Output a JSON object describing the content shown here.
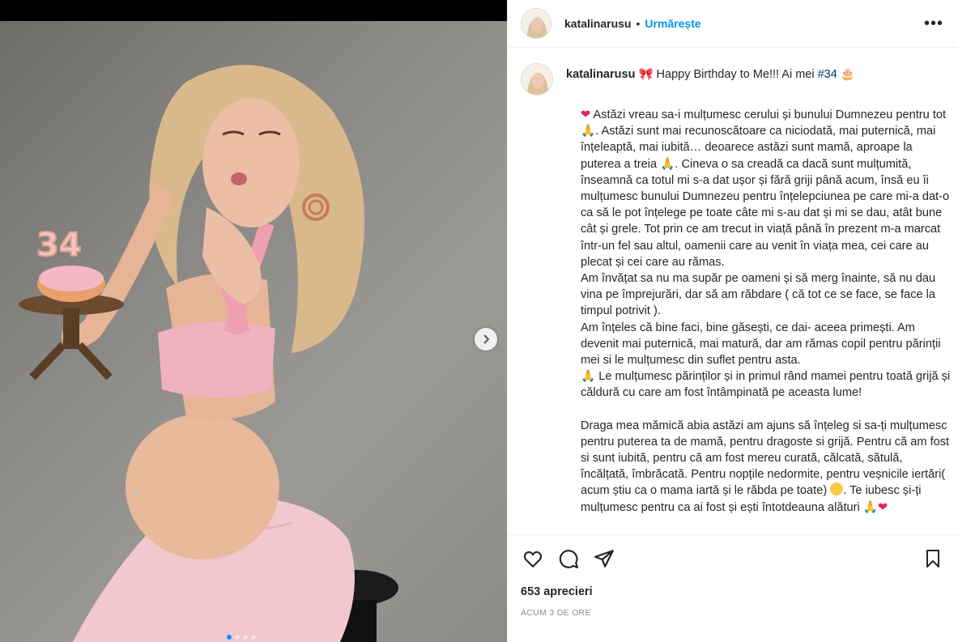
{
  "post": {
    "username": "katalinarusu",
    "follow_label": "Urmărește",
    "separator": "•",
    "more_label": "•••"
  },
  "caption": {
    "username": "katalinarusu",
    "bow_emoji": "🎀",
    "intro": " Happy Birthday to Me!!! Ai mei ",
    "hashtag": "#34",
    "cake_emoji": "🎂",
    "heart_emoji": "❤",
    "pray_emoji": "🙏",
    "p1a": " Astăzi vreau sa-i mulțumesc cerului și bunului Dumnezeu pentru tot ",
    "p1b": ". Astăzi sunt mai recunoscătoare ca niciodată, mai puternică, mai înțeleaptă, mai iubită… deoarece astăzi sunt mamă, aproape la puterea a treia ",
    "p1c": ". Cineva o sa creadă ca dacă sunt mulțumită, înseamnă ca totul mi s-a dat ușor și fără griji până acum, însă eu îi mulțumesc bunului Dumnezeu pentru înțelepciunea pe care mi-a dat-o ca să le pot înțelege pe toate câte mi s-au dat și mi se dau, atât bune cât și grele. Tot prin ce am trecut in viață până în prezent m-a marcat într-un fel sau altul, oamenii care au venit în viața mea, cei care au plecat și cei care au rămas.",
    "p2": "Am învățat sa nu ma supăr pe oameni și să merg înainte, să nu dau vina pe împrejurări, dar să am răbdare ( că tot ce se face, se face la timpul potrivit ).",
    "p3": "Am înțeles că bine faci, bine găsești, ce dai- aceea primești. Am devenit mai puternică, mai matură, dar am rămas copil pentru părinții mei si le mulțumesc din suflet pentru asta.",
    "p4": " Le mulțumesc părinților și in primul rând mamei pentru toată grijă și căldură cu care am fost întâmpinată pe aceasta lume!",
    "p5a": "Draga mea mămică abia astăzi am ajuns să înțeleg si sa-ți mulțumesc pentru puterea ta de mamă, pentru dragoste si grijă. Pentru că am fost si sunt iubită, pentru că am fost mereu curată, călcată, sătulă, încălțată, îmbrăcată. Pentru nopțile nedormite, pentru veșnicile iertări( acum știu ca o mama iartă și le răbda pe toate) ",
    "p5b": ". Te iubesc și-ți mulțumesc pentru ca ai fost și ești întotdeauna alături "
  },
  "stats": {
    "likes": "653 aprecieri",
    "time": "Acum 3 de ore"
  },
  "carousel": {
    "slides": 4,
    "active": 0
  },
  "colors": {
    "accent": "#0095f6",
    "hashtag": "#00376b",
    "muted": "#8e8e8e"
  }
}
